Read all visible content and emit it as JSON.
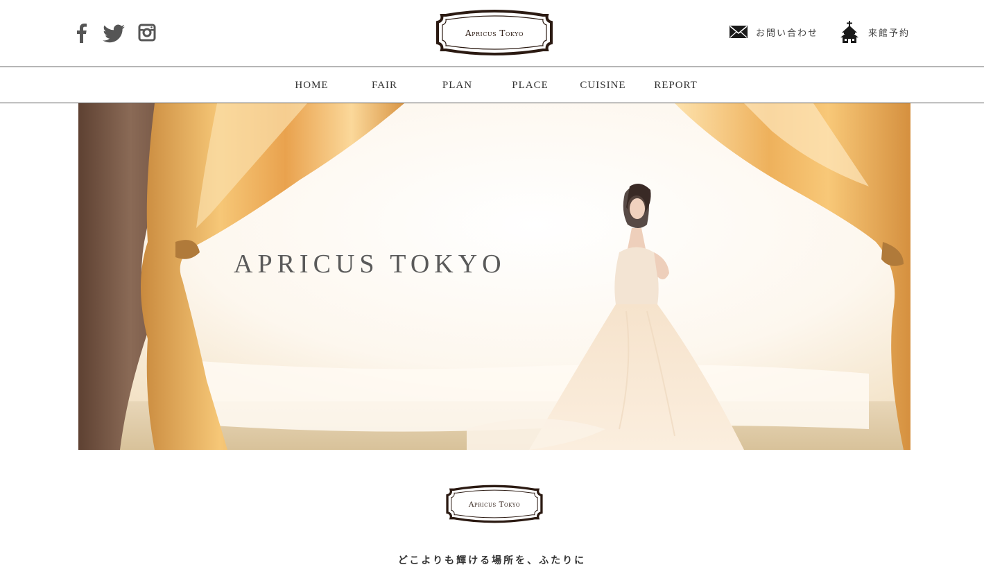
{
  "header": {
    "social": [
      {
        "name": "facebook-icon"
      },
      {
        "name": "twitter-icon"
      },
      {
        "name": "instagram-icon"
      }
    ],
    "logo_text": "Apricus Tokyo",
    "links": {
      "contact_label": "お問い合わせ",
      "contact_icon": "envelope-icon",
      "reserve_label": "来館予約",
      "reserve_icon": "chapel-icon"
    }
  },
  "nav": {
    "items": [
      "HOME",
      "FAIR",
      "PLAN",
      "PLACE",
      "CUISINE",
      "REPORT"
    ]
  },
  "hero": {
    "title": "APRICUS TOKYO"
  },
  "section": {
    "logo_text": "Apricus Tokyo",
    "tagline": "どこよりも輝ける場所を、ふたりに"
  },
  "colors": {
    "logo_brown": "#2b1a12",
    "text": "#333333",
    "curtain_gold": "#f0b860",
    "curtain_brown": "#7a5a48"
  }
}
